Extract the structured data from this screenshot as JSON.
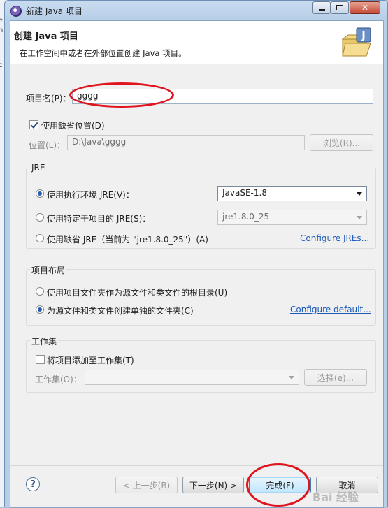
{
  "background": {
    "side_texts": [
      "e",
      "n",
      "c"
    ]
  },
  "window": {
    "title": "新建 Java 项目",
    "controls": {
      "minimize": "–",
      "maximize": "□",
      "close": "✕"
    }
  },
  "banner": {
    "title": "创建 Java 项目",
    "description": "在工作空间中或者在外部位置创建 Java 项目。",
    "icon": "java-project-folder-icon"
  },
  "project_name": {
    "label": "项目名(P)：",
    "value": "gggg"
  },
  "location": {
    "use_default_label": "使用缺省位置(D)",
    "use_default_checked": true,
    "label": "位置(L)：",
    "value": "D:\\Java\\gggg",
    "browse_button": "浏览(R)..."
  },
  "jre": {
    "group_title": "JRE",
    "options": [
      {
        "label": "使用执行环境 JRE(V)：",
        "selected": true
      },
      {
        "label": "使用特定于项目的 JRE(S)：",
        "selected": false
      },
      {
        "label": "使用缺省 JRE（当前为 \"jre1.8.0_25\"）(A)",
        "selected": false
      }
    ],
    "env_select": "JavaSE-1.8",
    "specific_select": "jre1.8.0_25",
    "configure_link": "Configure JREs..."
  },
  "layout": {
    "group_title": "项目布局",
    "options": [
      {
        "label": "使用项目文件夹作为源文件和类文件的根目录(U)",
        "selected": false
      },
      {
        "label": "为源文件和类文件创建单独的文件夹(C)",
        "selected": true
      }
    ],
    "configure_link": "Configure default..."
  },
  "working_sets": {
    "group_title": "工作集",
    "add_label": "将项目添加至工作集(T)",
    "add_checked": false,
    "label": "工作集(O)：",
    "select_value": "",
    "select_button": "选择(e)..."
  },
  "footer": {
    "help": "?",
    "back": "< 上一步(B)",
    "next": "下一步(N) >",
    "finish": "完成(F)",
    "cancel": "取消"
  },
  "watermark": "Bai 经验",
  "colors": {
    "accent": "#1c5ab8",
    "annotation": "#e0141e",
    "selected_radio": "#2a5db0"
  }
}
